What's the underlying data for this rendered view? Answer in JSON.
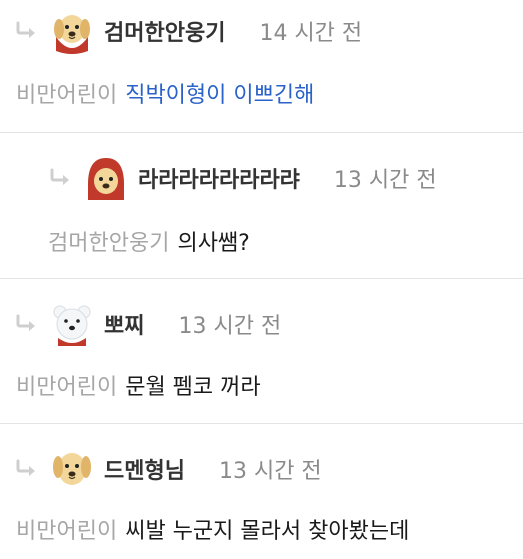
{
  "comments": [
    {
      "nickname": "검머한안웅기",
      "time": "14 시간 전",
      "mention": "비만어린이",
      "text": "직박이형이 이쁘긴해",
      "avatar": "puppy-red-cape-icon"
    },
    {
      "nickname": "라라라라라라라랴",
      "time": "13 시간 전",
      "mention": "검머한안웅기",
      "text": "의사쌤?",
      "avatar": "puppy-red-hood-icon"
    },
    {
      "nickname": "뽀찌",
      "time": "13 시간 전",
      "mention": "비만어린이",
      "text": "문월 펨코 꺼라",
      "avatar": "polar-bear-icon"
    },
    {
      "nickname": "드멘형님",
      "time": "13 시간 전",
      "mention": "비만어린이",
      "text": "씨발 누군지 몰라서 찾아봤는데",
      "avatar": "puppy-icon"
    }
  ],
  "colors": {
    "link": "#2a62c9",
    "muted": "#8a8a8a",
    "mention": "#a6a6a6",
    "arrow": "#cfcfcf"
  }
}
